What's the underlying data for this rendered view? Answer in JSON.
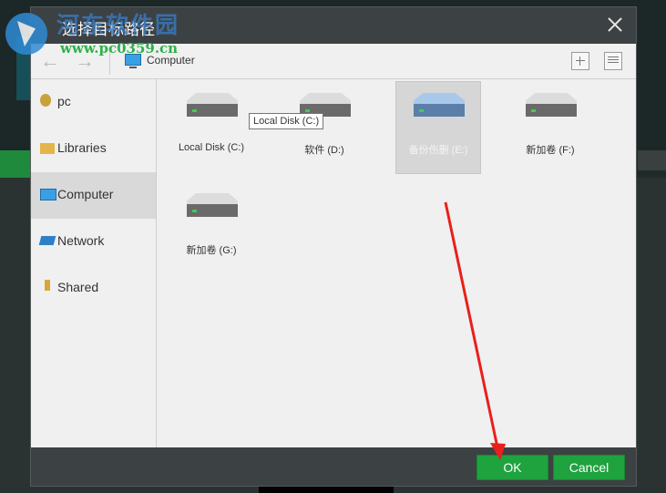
{
  "watermark": {
    "title": "河东软件园",
    "url": "www.pc0359.cn"
  },
  "dialog": {
    "title": "选择目标路径",
    "close_icon": "close-icon"
  },
  "toolbar": {
    "path": "Computer",
    "back_icon": "arrow-left-icon",
    "forward_icon": "arrow-right-icon",
    "new_folder_icon": "new-folder-icon",
    "view_icon": "list-view-icon"
  },
  "sidebar": {
    "items": [
      {
        "label": "pc",
        "icon": "user-icon"
      },
      {
        "label": "Libraries",
        "icon": "libraries-icon"
      },
      {
        "label": "Computer",
        "icon": "computer-icon",
        "selected": true
      },
      {
        "label": "Network",
        "icon": "network-icon"
      },
      {
        "label": "Shared",
        "icon": "shared-icon"
      }
    ]
  },
  "drives": [
    {
      "label": "Local Disk (C:)"
    },
    {
      "label": "软件 (D:)"
    },
    {
      "label": "备份伤删 (E:)",
      "selected": true
    },
    {
      "label": "新加卷 (F:)"
    },
    {
      "label": "新加卷 (G:)"
    }
  ],
  "tooltip": "Local Disk (C:)",
  "footer": {
    "ok_label": "OK",
    "cancel_label": "Cancel"
  },
  "colors": {
    "accent": "#1fa33f",
    "dialog_bg": "#3c4143",
    "annotation_arrow": "#e8201c"
  }
}
